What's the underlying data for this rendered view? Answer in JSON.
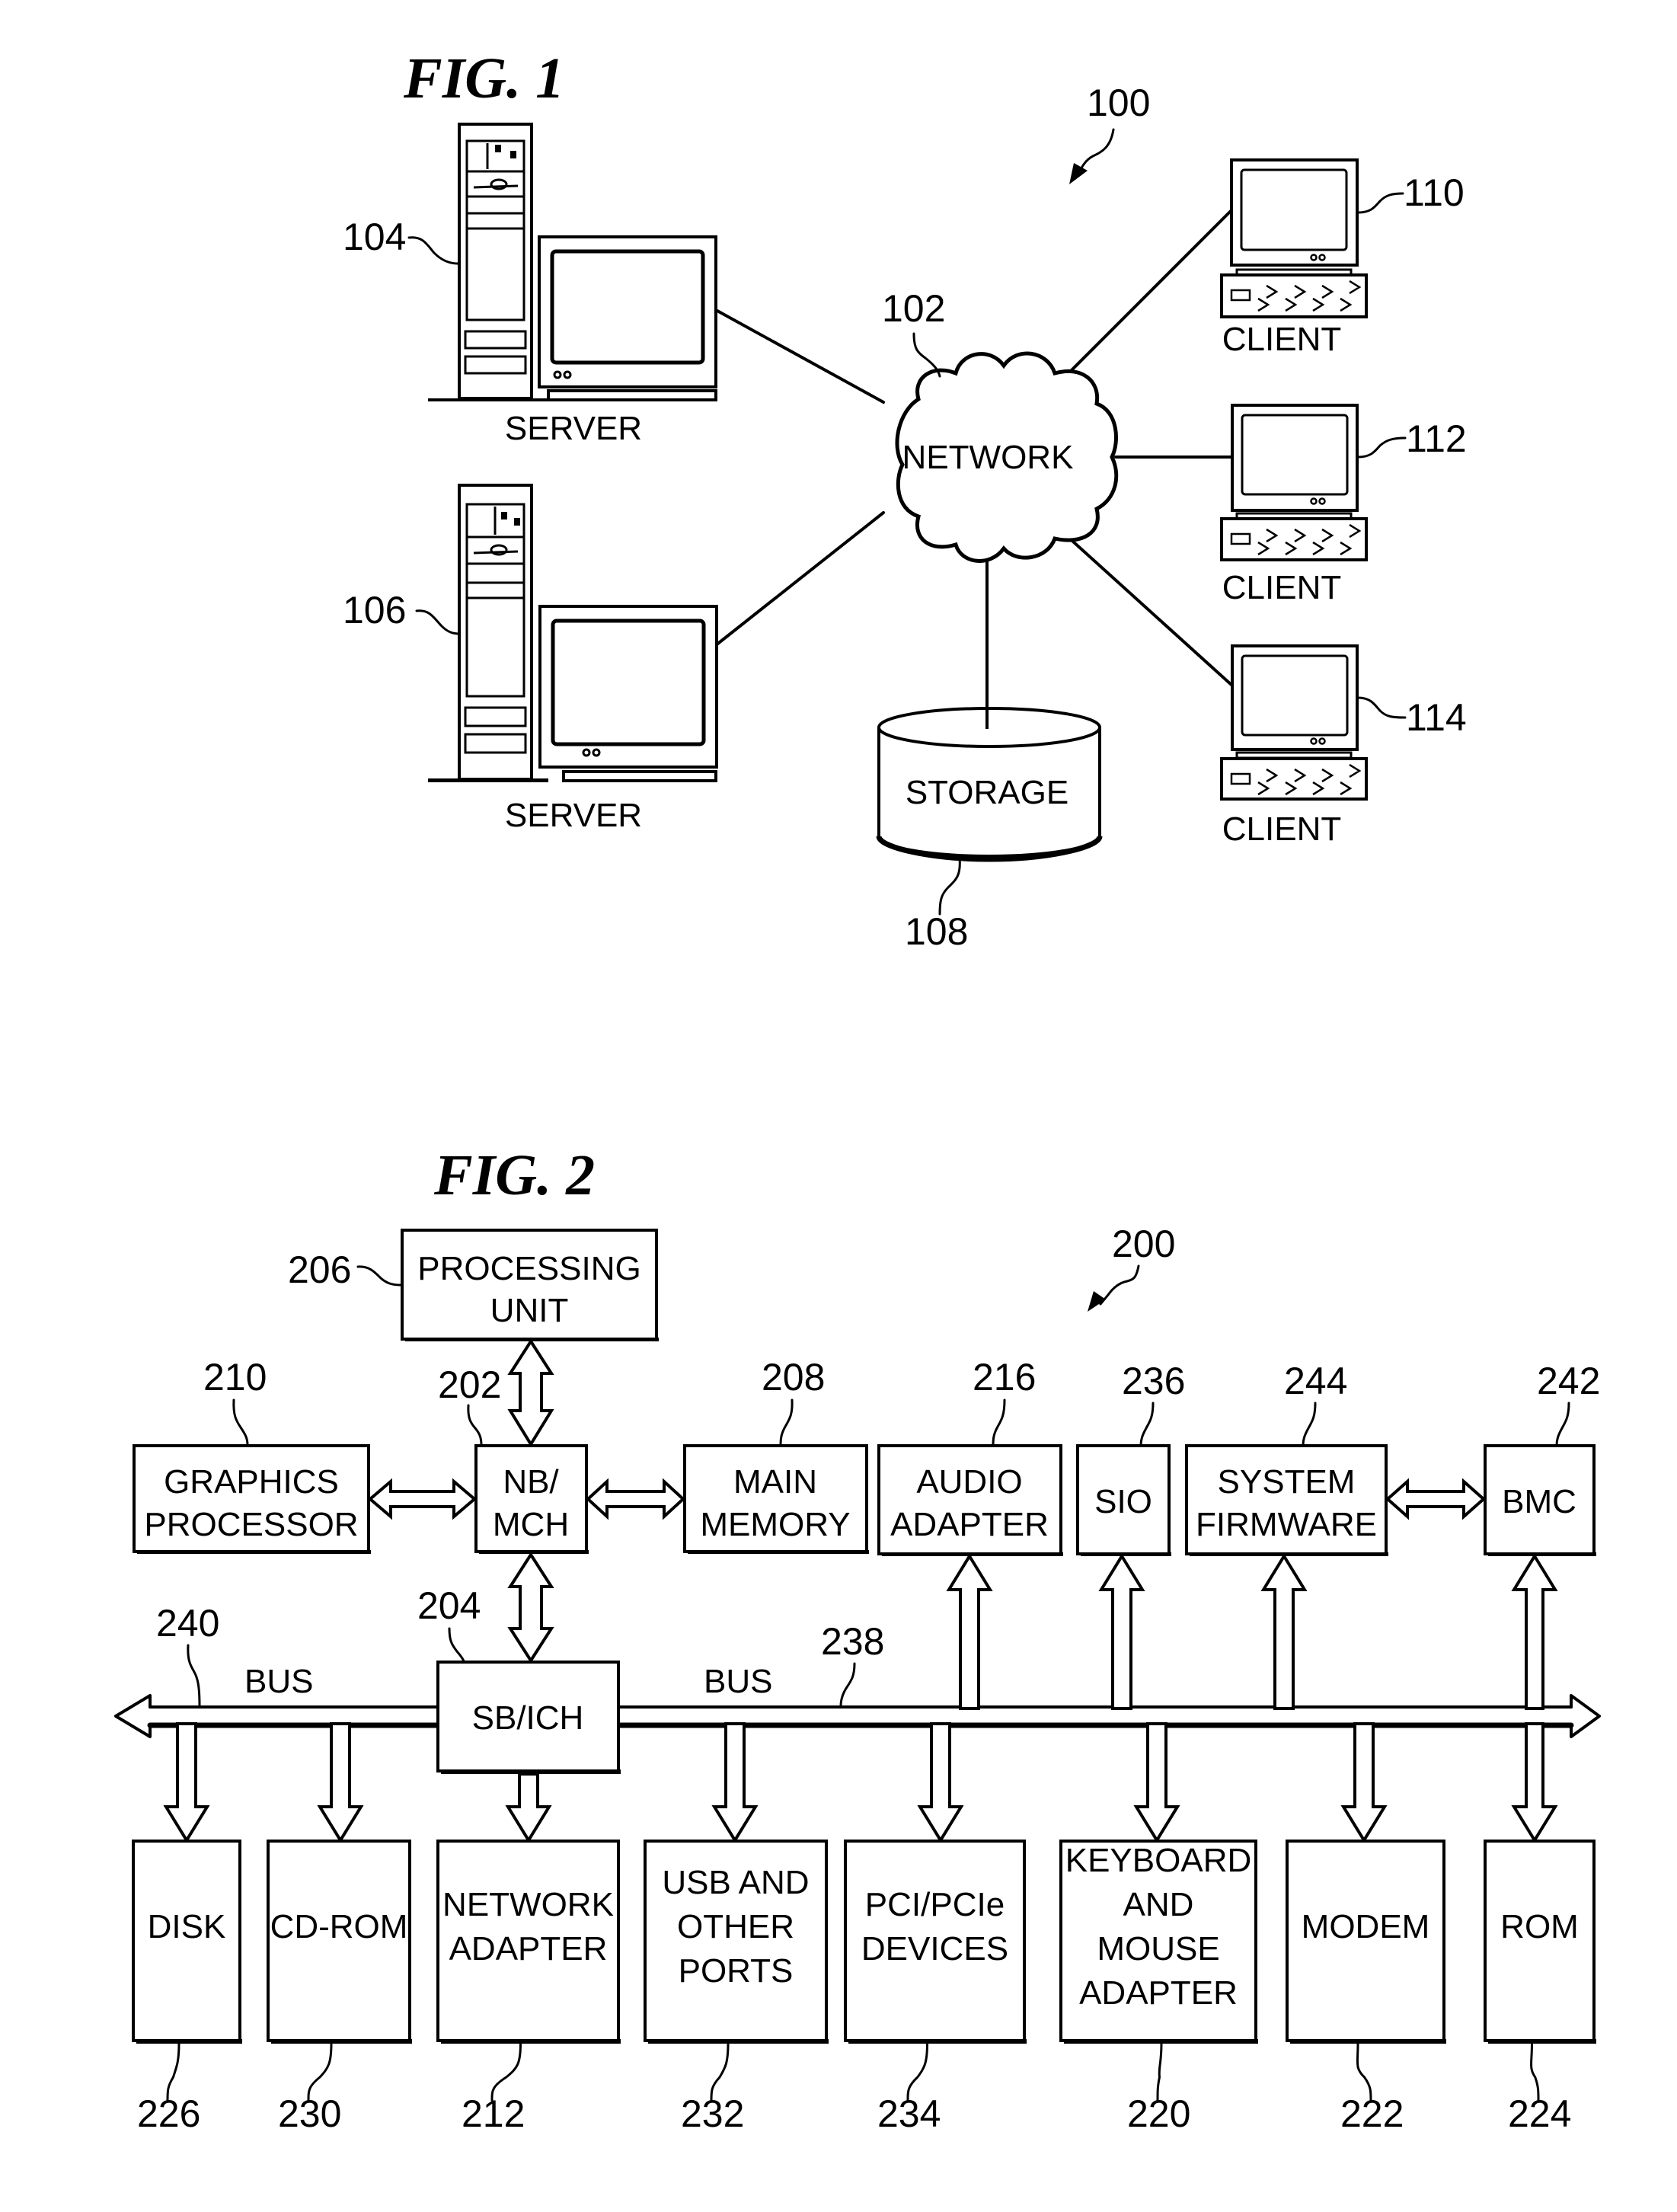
{
  "fig1": {
    "title": "FIG. 1",
    "ref_system": "100",
    "network": {
      "label": "NETWORK",
      "ref": "102"
    },
    "servers": [
      {
        "label": "SERVER",
        "ref": "104"
      },
      {
        "label": "SERVER",
        "ref": "106"
      }
    ],
    "storage": {
      "label": "STORAGE",
      "ref": "108"
    },
    "clients": [
      {
        "label": "CLIENT",
        "ref": "110"
      },
      {
        "label": "CLIENT",
        "ref": "112"
      },
      {
        "label": "CLIENT",
        "ref": "114"
      }
    ]
  },
  "fig2": {
    "title": "FIG. 2",
    "ref_system": "200",
    "processing_unit": {
      "lines": [
        "PROCESSING",
        "UNIT"
      ],
      "ref": "206"
    },
    "nb_mch": {
      "lines": [
        "NB/",
        "MCH"
      ],
      "ref": "202"
    },
    "graphics": {
      "lines": [
        "GRAPHICS",
        "PROCESSOR"
      ],
      "ref": "210"
    },
    "main_memory": {
      "lines": [
        "MAIN",
        "MEMORY"
      ],
      "ref": "208"
    },
    "audio": {
      "lines": [
        "AUDIO",
        "ADAPTER"
      ],
      "ref": "216"
    },
    "sio": {
      "lines": [
        "SIO"
      ],
      "ref": "236"
    },
    "firmware": {
      "lines": [
        "SYSTEM",
        "FIRMWARE"
      ],
      "ref": "244"
    },
    "bmc": {
      "lines": [
        "BMC"
      ],
      "ref": "242"
    },
    "sb_ich": {
      "lines": [
        "SB/ICH"
      ],
      "ref": "204"
    },
    "bus_left": {
      "label": "BUS",
      "ref": "240"
    },
    "bus_right": {
      "label": "BUS",
      "ref": "238"
    },
    "bottom": [
      {
        "lines": [
          "DISK"
        ],
        "ref": "226"
      },
      {
        "lines": [
          "CD-ROM"
        ],
        "ref": "230"
      },
      {
        "lines": [
          "NETWORK",
          "ADAPTER"
        ],
        "ref": "212"
      },
      {
        "lines": [
          "USB AND",
          "OTHER",
          "PORTS"
        ],
        "ref": "232"
      },
      {
        "lines": [
          "PCI/PCIe",
          "DEVICES"
        ],
        "ref": "234"
      },
      {
        "lines": [
          "KEYBOARD",
          "AND",
          "MOUSE",
          "ADAPTER"
        ],
        "ref": "220"
      },
      {
        "lines": [
          "MODEM"
        ],
        "ref": "222"
      },
      {
        "lines": [
          "ROM"
        ],
        "ref": "224"
      }
    ]
  }
}
